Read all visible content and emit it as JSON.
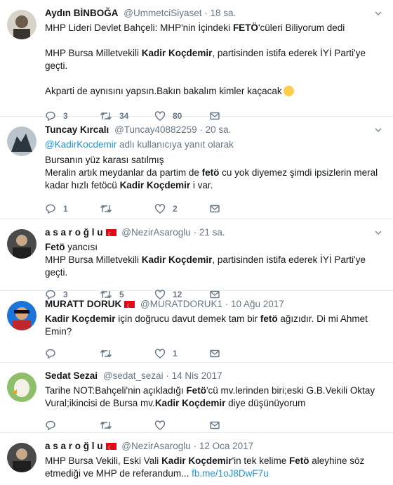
{
  "tweets": [
    {
      "name": "Aydın BİNBOĞA",
      "handle": "@UmmetciSiyaset",
      "time": "18 sa.",
      "lines": [
        [
          "MHP Lideri Devlet Bahçeli: MHP'nin İçindeki ",
          "FETÖ",
          "'cüleri Biliyorum dedi"
        ],
        [
          "MHP Bursa Milletvekili ",
          "Kadir Koçdemir",
          ", partisinden istifa ederek İYİ Parti'ye geçti."
        ],
        [
          "Akparti de aynısını yapsın.Bakın bakalım kimler kaçacak"
        ]
      ],
      "replies": "3",
      "retweets": "34",
      "likes": "80"
    },
    {
      "name": "Tuncay Kırcalı",
      "handle": "@Tuncay40882259",
      "time": "20 sa.",
      "reply_to_handle": "@KadirKocdemir",
      "reply_to_suffix": " adlı kullanıcıya yanıt olarak",
      "l1": "Bursanın yüz karası satılmış",
      "l2a": "Meralin artık meydanlar da partim de ",
      "l2b": "fetö",
      "l2c": " cu yok diyemez şimdi ipsizlerin meral",
      "l3a": "kadar hızlı fetöcü ",
      "l3b": "Kadir Koçdemir",
      "l3c": " i var.",
      "replies": "1",
      "retweets": "",
      "likes": "2"
    },
    {
      "name": "a s a r o ğ l u",
      "handle": "@NezirAsaroglu",
      "time": "21 sa.",
      "l1a": "Fetö",
      "l1b": " yancısı",
      "l2a": "MHP Bursa Milletvekili ",
      "l2b": "Kadir Koçdemir",
      "l2c": ", partisinden istifa ederek İYİ Parti'ye geçti.",
      "replies": "3",
      "retweets": "5",
      "likes": "12"
    },
    {
      "name": "MURATT DORUK",
      "handle": "@MURATDORUK1",
      "time": "10 Ağu 2017",
      "l1a": "Kadir Koçdemir",
      "l1b": " için doğrucu davut demek tam bir ",
      "l1c": "fetö",
      "l1d": " ağızıdır. Di mi Ahmet",
      "l2": "Emin?",
      "replies": "",
      "retweets": "",
      "likes": "1"
    },
    {
      "name": "Sedat Sezai",
      "handle": "@sedat_sezai",
      "time": "14 Nis 2017",
      "l1a": "Tarihe NOT:Bahçeli'nin açıkladığı ",
      "l1b": "Fetö",
      "l1c": "'cü mv.lerinden biri;eski G.B.Vekili Oktay",
      "l2a": "Vural;ikincisi de Bursa mv.",
      "l2b": "Kadir Koçdemir",
      "l2c": " diye düşünüyorum",
      "replies": "",
      "retweets": "",
      "likes": ""
    },
    {
      "name": "a s a r o ğ l u",
      "handle": "@NezirAsaroglu",
      "time": "12 Oca 2017",
      "l1a": "MHP Bursa Vekili, Eski Vali ",
      "l1b": "Kadir Koçdemir",
      "l1c": "'in tek kelime ",
      "l1d": "Fetö",
      "l1e": " aleyhine söz",
      "l2a": "etmediği ve MHP de referandum... ",
      "l2b": "fb.me/1oJ8DwF7u"
    }
  ],
  "colors": {
    "link": "#1b95e0",
    "meta": "#657786",
    "divider": "#e6ecf0",
    "flag": "#e30a17"
  }
}
